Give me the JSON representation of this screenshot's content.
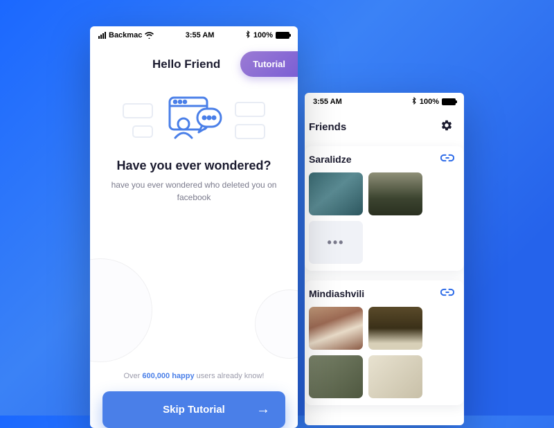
{
  "statusbar": {
    "carrier": "Backmac",
    "time": "3:55 AM",
    "time2": "3:55 AM",
    "bluetooth": "100%",
    "bluetooth2": "100%"
  },
  "front": {
    "title": "Hello Friend",
    "tutorial_btn": "Tutorial",
    "heading": "Have you ever wondered?",
    "subtext": "have you ever wondered who deleted you on facebook",
    "happy_pre": "Over ",
    "happy_num": "600,000 happy",
    "happy_post": " users already know!",
    "skip": "Skip Tutorial"
  },
  "back": {
    "title": "Friends",
    "card1_name": "Saralidze",
    "card2_name": "Mindiashvili",
    "more": "•••"
  }
}
